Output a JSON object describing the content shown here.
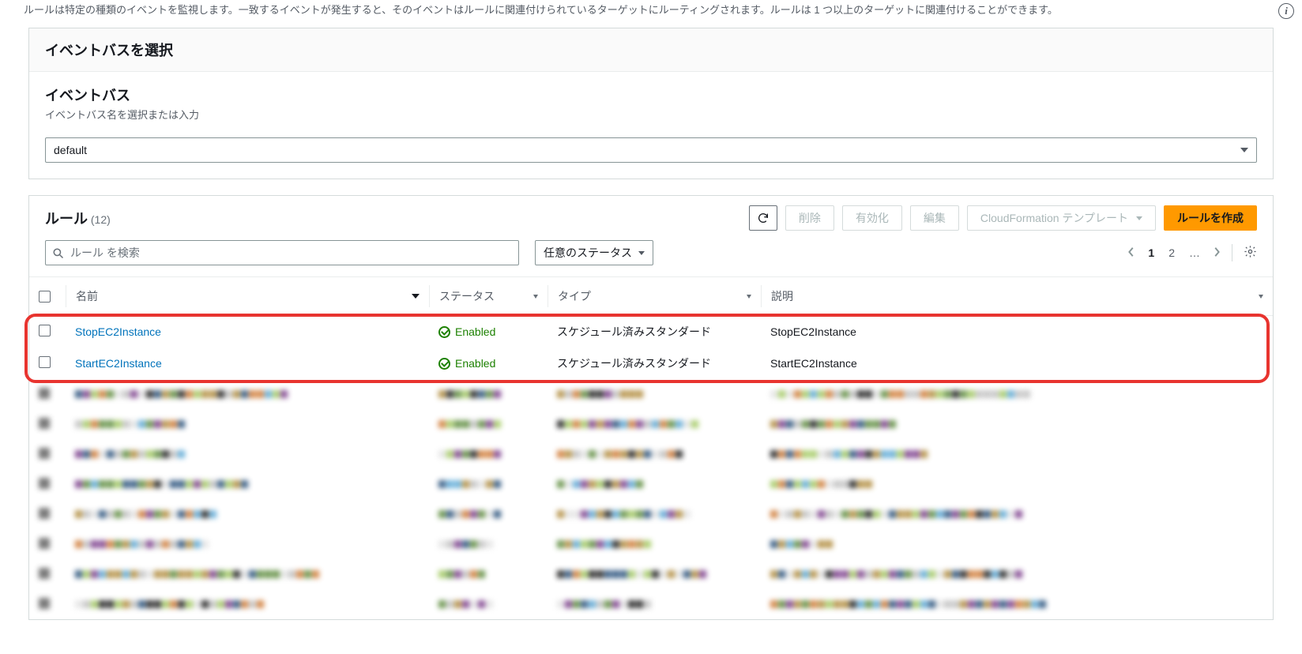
{
  "top_description": "ルールは特定の種類のイベントを監視します。一致するイベントが発生すると、そのイベントはルールに関連付けられているターゲットにルーティングされます。ルールは 1 つ以上のターゲットに関連付けることができます。",
  "eventbus_panel": {
    "header": "イベントバスを選択",
    "label": "イベントバス",
    "hint": "イベントバス名を選択または入力",
    "selected": "default"
  },
  "rules": {
    "title": "ルール",
    "count_display": "(12)",
    "buttons": {
      "delete": "削除",
      "enable": "有効化",
      "edit": "編集",
      "cf_template": "CloudFormation テンプレート",
      "create": "ルールを作成"
    },
    "search_placeholder": "ルール を検索",
    "status_filter": "任意のステータス",
    "pagination": {
      "page1": "1",
      "page2": "2",
      "ellipsis": "…"
    },
    "columns": {
      "name": "名前",
      "status": "ステータス",
      "type": "タイプ",
      "description": "説明"
    },
    "rows": [
      {
        "name": "StopEC2Instance",
        "status": "Enabled",
        "type": "スケジュール済みスタンダード",
        "description": "StopEC2Instance",
        "highlight": true
      },
      {
        "name": "StartEC2Instance",
        "status": "Enabled",
        "type": "スケジュール済みスタンダード",
        "description": "StartEC2Instance",
        "highlight": true
      }
    ],
    "blurred_row_count": 8
  }
}
